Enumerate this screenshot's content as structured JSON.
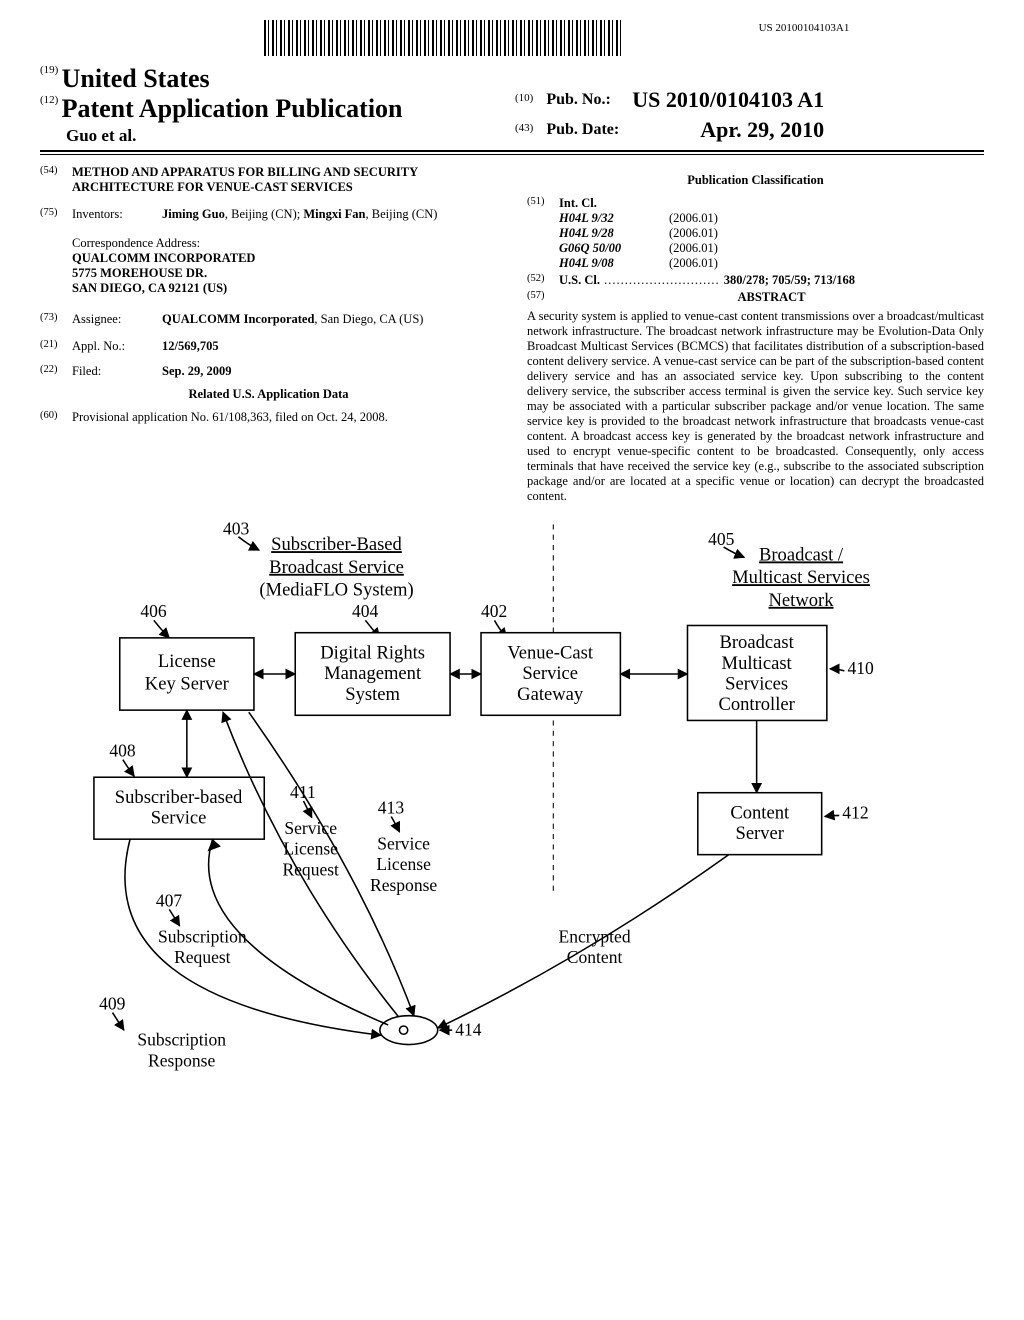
{
  "barcode_number": "US 20100104103A1",
  "code19": "(19)",
  "code12": "(12)",
  "code10": "(10)",
  "code43": "(43)",
  "code54": "(54)",
  "code75": "(75)",
  "code73": "(73)",
  "code21": "(21)",
  "code22": "(22)",
  "code60": "(60)",
  "code51": "(51)",
  "code52": "(52)",
  "code57": "(57)",
  "country": "United States",
  "pub_type": "Patent Application Publication",
  "author_line": "Guo et al.",
  "pubno_label": "Pub. No.:",
  "pubno_value": "US 2010/0104103 A1",
  "pubdate_label": "Pub. Date:",
  "pubdate_value": "Apr. 29, 2010",
  "title": "METHOD AND APPARATUS FOR BILLING AND SECURITY ARCHITECTURE FOR VENUE-CAST SERVICES",
  "inventors_label": "Inventors:",
  "inventors_value_1a": "Jiming Guo",
  "inventors_value_1b": ", Beijing (CN); ",
  "inventors_value_2a": "Mingxi Fan",
  "inventors_value_2b": ", Beijing (CN)",
  "correspondence_label": "Correspondence Address:",
  "correspondence_l1": "QUALCOMM INCORPORATED",
  "correspondence_l2": "5775 MOREHOUSE DR.",
  "correspondence_l3": "SAN DIEGO, CA 92121 (US)",
  "assignee_label": "Assignee:",
  "assignee_value_a": "QUALCOMM Incorporated",
  "assignee_value_b": ", San Diego, CA (US)",
  "applno_label": "Appl. No.:",
  "applno_value": "12/569,705",
  "filed_label": "Filed:",
  "filed_value": "Sep. 29, 2009",
  "related_heading": "Related U.S. Application Data",
  "provisional": "Provisional application No. 61/108,363, filed on Oct. 24, 2008.",
  "class_heading": "Publication Classification",
  "intcl_label": "Int. Cl.",
  "ipc": [
    {
      "code": "H04L 9/32",
      "date": "(2006.01)"
    },
    {
      "code": "H04L 9/28",
      "date": "(2006.01)"
    },
    {
      "code": "G06Q 50/00",
      "date": "(2006.01)"
    },
    {
      "code": "H04L 9/08",
      "date": "(2006.01)"
    }
  ],
  "uscl_label": "U.S. Cl.",
  "uscl_dots": " ............................ ",
  "uscl_value": "380/278; 705/59; 713/168",
  "abstract_label": "ABSTRACT",
  "abstract_text": "A security system is applied to venue-cast content transmissions over a broadcast/multicast network infrastructure. The broadcast network infrastructure may be Evolution-Data Only Broadcast Multicast Services (BCMCS) that facilitates distribution of a subscription-based content delivery service. A venue-cast service can be part of the subscription-based content delivery service and has an associated service key. Upon subscribing to the content delivery service, the subscriber access terminal is given the service key. Such service key may be associated with a particular subscriber package and/or venue location. The same service key is provided to the broadcast network infrastructure that broadcasts venue-cast content. A broadcast access key is generated by the broadcast network infrastructure and used to encrypt venue-specific content to be broadcasted. Consequently, only access terminals that have received the service key (e.g., subscribe to the associated subscription package and/or are located at a specific venue or location) can decrypt the broadcasted content.",
  "figure": {
    "labels": {
      "n402": "402",
      "n403": "403",
      "n404": "404",
      "n405": "405",
      "n406": "406",
      "n407": "407",
      "n408": "408",
      "n409": "409",
      "n410": "410",
      "n411": "411",
      "n412": "412",
      "n413": "413",
      "n414": "414"
    },
    "t403a": "Subscriber-Based",
    "t403b": "Broadcast Service",
    "t403c": "(MediaFLO System)",
    "t405a": "Broadcast /",
    "t405b": "Multicast Services",
    "t405c": "Network",
    "b406a": "License",
    "b406b": "Key Server",
    "b404a": "Digital Rights",
    "b404b": "Management",
    "b404c": "System",
    "b402a": "Venue-Cast",
    "b402b": "Service",
    "b402c": "Gateway",
    "b410a": "Broadcast",
    "b410b": "Multicast",
    "b410c": "Services",
    "b410d": "Controller",
    "b408a": "Subscriber-based",
    "b408b": "Service",
    "b412a": "Content",
    "b412b": "Server",
    "t411a": "Service",
    "t411b": "License",
    "t411c": "Request",
    "t413a": "Service",
    "t413b": "License",
    "t413c": "Response",
    "t407a": "Subscription",
    "t407b": "Request",
    "t409a": "Subscription",
    "t409b": "Response",
    "tEnc": "Encrypted",
    "tEnc2": "Content"
  }
}
